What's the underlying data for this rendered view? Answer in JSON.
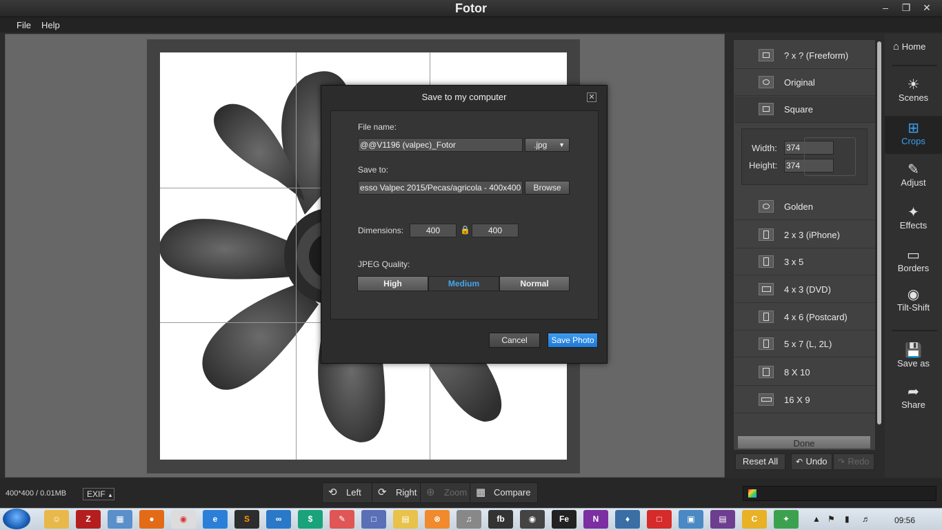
{
  "app": {
    "title": "Fotor",
    "window_controls": [
      "minimize",
      "maximize",
      "close"
    ]
  },
  "menu": [
    "File",
    "Help"
  ],
  "dialog": {
    "title": "Save to my computer",
    "file_name_label": "File name:",
    "file_name_value": "@@V1196 (valpec)_Fotor",
    "file_type": ".jpg",
    "save_to_label": "Save to:",
    "save_to_value": "esso Valpec 2015/Pecas/agricola - 400x400",
    "browse_label": "Browse",
    "dimensions_label": "Dimensions:",
    "width_value": "400",
    "height_value": "400",
    "jpeg_quality_label": "JPEG Quality:",
    "quality_options": [
      "High",
      "Medium",
      "Normal"
    ],
    "quality_selected": "Medium",
    "cancel_label": "Cancel",
    "save_label": "Save Photo"
  },
  "crop_panel": {
    "presets": [
      {
        "label": "? x ?  (Freeform)",
        "icon": "hand-icon"
      },
      {
        "label": "Original",
        "icon": "original-icon"
      },
      {
        "label": "Square",
        "icon": "square-icon"
      },
      {
        "label": "Golden",
        "icon": "spiral-icon"
      },
      {
        "label": "2 x 3  (iPhone)",
        "icon": "portrait-icon"
      },
      {
        "label": "3 x 5",
        "icon": "portrait-icon"
      },
      {
        "label": "4 x 3  (DVD)",
        "icon": "landscape-icon"
      },
      {
        "label": "4 x 6  (Postcard)",
        "icon": "portrait-icon"
      },
      {
        "label": "5 x 7  (L, 2L)",
        "icon": "portrait-icon"
      },
      {
        "label": "8 X 10",
        "icon": "portrait-icon"
      },
      {
        "label": "16 X 9",
        "icon": "wide-icon"
      }
    ],
    "width_label": "Width:",
    "width_value": "374",
    "height_label": "Height:",
    "height_value": "374",
    "done_label": "Done",
    "reset_label": "Reset All",
    "undo_label": "Undo",
    "redo_label": "Redo"
  },
  "sidebar": {
    "home": "Home",
    "items": [
      "Scenes",
      "Crops",
      "Adjust",
      "Effects",
      "Borders",
      "Tilt-Shift"
    ],
    "active": "Crops",
    "save_as": "Save as",
    "share": "Share"
  },
  "status": {
    "info": "400*400 / 0.01MB",
    "exif": "EXIF",
    "tools": [
      "Left",
      "Right",
      "Zoom",
      "Compare"
    ]
  },
  "taskbar": {
    "time": "09:56"
  }
}
